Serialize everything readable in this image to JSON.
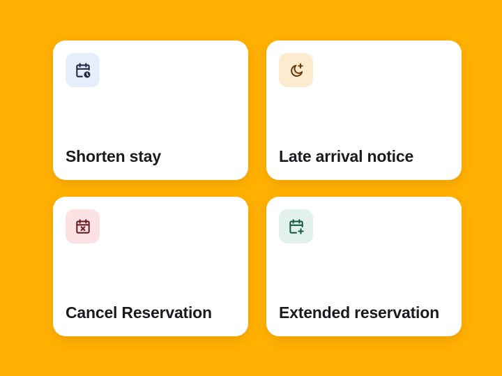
{
  "cards": [
    {
      "label": "Shorten stay",
      "icon": "calendar-clock-icon",
      "tile_color": "#E6EEFB",
      "icon_color": "#1E2A44"
    },
    {
      "label": "Late arrival notice",
      "icon": "moon-star-icon",
      "tile_color": "#FDEBCF",
      "icon_color": "#6B3A0C"
    },
    {
      "label": "Cancel Reservation",
      "icon": "calendar-x-icon",
      "tile_color": "#FCE2E2",
      "icon_color": "#6B1F24"
    },
    {
      "label": "Extended reservation",
      "icon": "calendar-plus-icon",
      "tile_color": "#E2F1EC",
      "icon_color": "#155C44"
    }
  ]
}
